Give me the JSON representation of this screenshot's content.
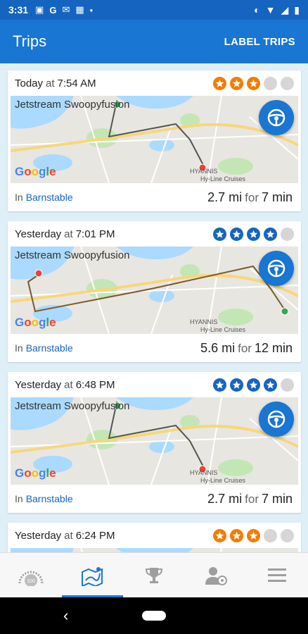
{
  "status": {
    "time": "3:31"
  },
  "appbar": {
    "title": "Trips",
    "action": "LABEL TRIPS"
  },
  "trips": [
    {
      "day": "Today",
      "at": "at",
      "time": "7:54 AM",
      "rating": 3,
      "star_color": "#f57c00",
      "map_label": "Jetstream Swoopyfusion",
      "loc_prefix": "In",
      "location": "Barnstable",
      "distance": "2.7 mi",
      "for": "for",
      "duration": "7 min"
    },
    {
      "day": "Yesterday",
      "at": "at",
      "time": "7:01 PM",
      "rating": 4,
      "star_color": "#1565c0",
      "map_label": "Jetstream Swoopyfusion",
      "loc_prefix": "In",
      "location": "Barnstable",
      "distance": "5.6 mi",
      "for": "for",
      "duration": "12 min"
    },
    {
      "day": "Yesterday",
      "at": "at",
      "time": "6:48 PM",
      "rating": 4,
      "star_color": "#1565c0",
      "map_label": "Jetstream Swoopyfusion",
      "loc_prefix": "In",
      "location": "Barnstable",
      "distance": "2.7 mi",
      "for": "for",
      "duration": "7 min"
    },
    {
      "day": "Yesterday",
      "at": "at",
      "time": "6:24 PM",
      "rating": 3,
      "star_color": "#f57c00"
    }
  ],
  "map": {
    "google": "Google",
    "hyannis": "HYANNIS",
    "hyline": "Hy-Line Cruises"
  },
  "bottom_nav": [
    {
      "name": "score-tab",
      "icon": "gauge-icon",
      "label": "100"
    },
    {
      "name": "trips-tab",
      "icon": "map-route-icon",
      "active": true
    },
    {
      "name": "rewards-tab",
      "icon": "trophy-icon"
    },
    {
      "name": "profile-tab",
      "icon": "driver-profile-icon"
    },
    {
      "name": "menu-tab",
      "icon": "hamburger-menu-icon"
    }
  ],
  "colors": {
    "primary": "#1976d2",
    "statusbar": "#1565c0",
    "orange": "#f57c00"
  }
}
